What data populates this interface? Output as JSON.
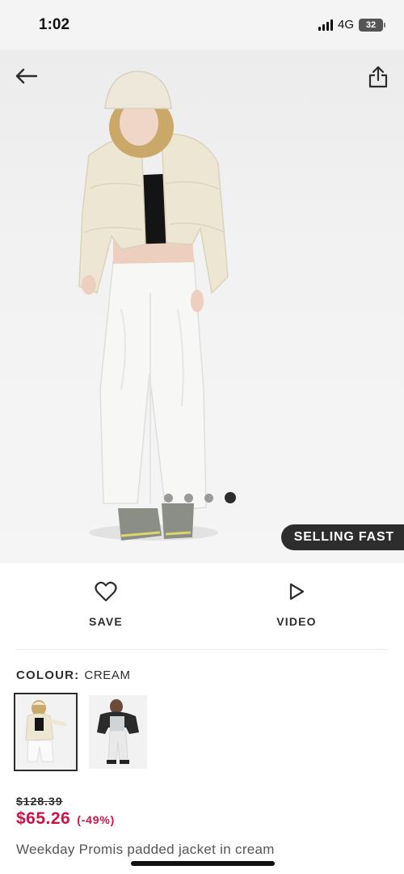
{
  "status_bar": {
    "time": "1:02",
    "network": "4G",
    "battery": "32"
  },
  "hero": {
    "badge": "SELLING FAST",
    "carousel": {
      "total": 4,
      "active": 4
    }
  },
  "actions": {
    "save_label": "SAVE",
    "video_label": "VIDEO"
  },
  "colour": {
    "label": "COLOUR:",
    "value": "CREAM"
  },
  "pricing": {
    "original_price": "$128.39",
    "sale_price": "$65.26",
    "discount": "(-49%)",
    "sale_color": "#d01345"
  },
  "product": {
    "name": "Weekday Promis padded jacket in cream"
  }
}
